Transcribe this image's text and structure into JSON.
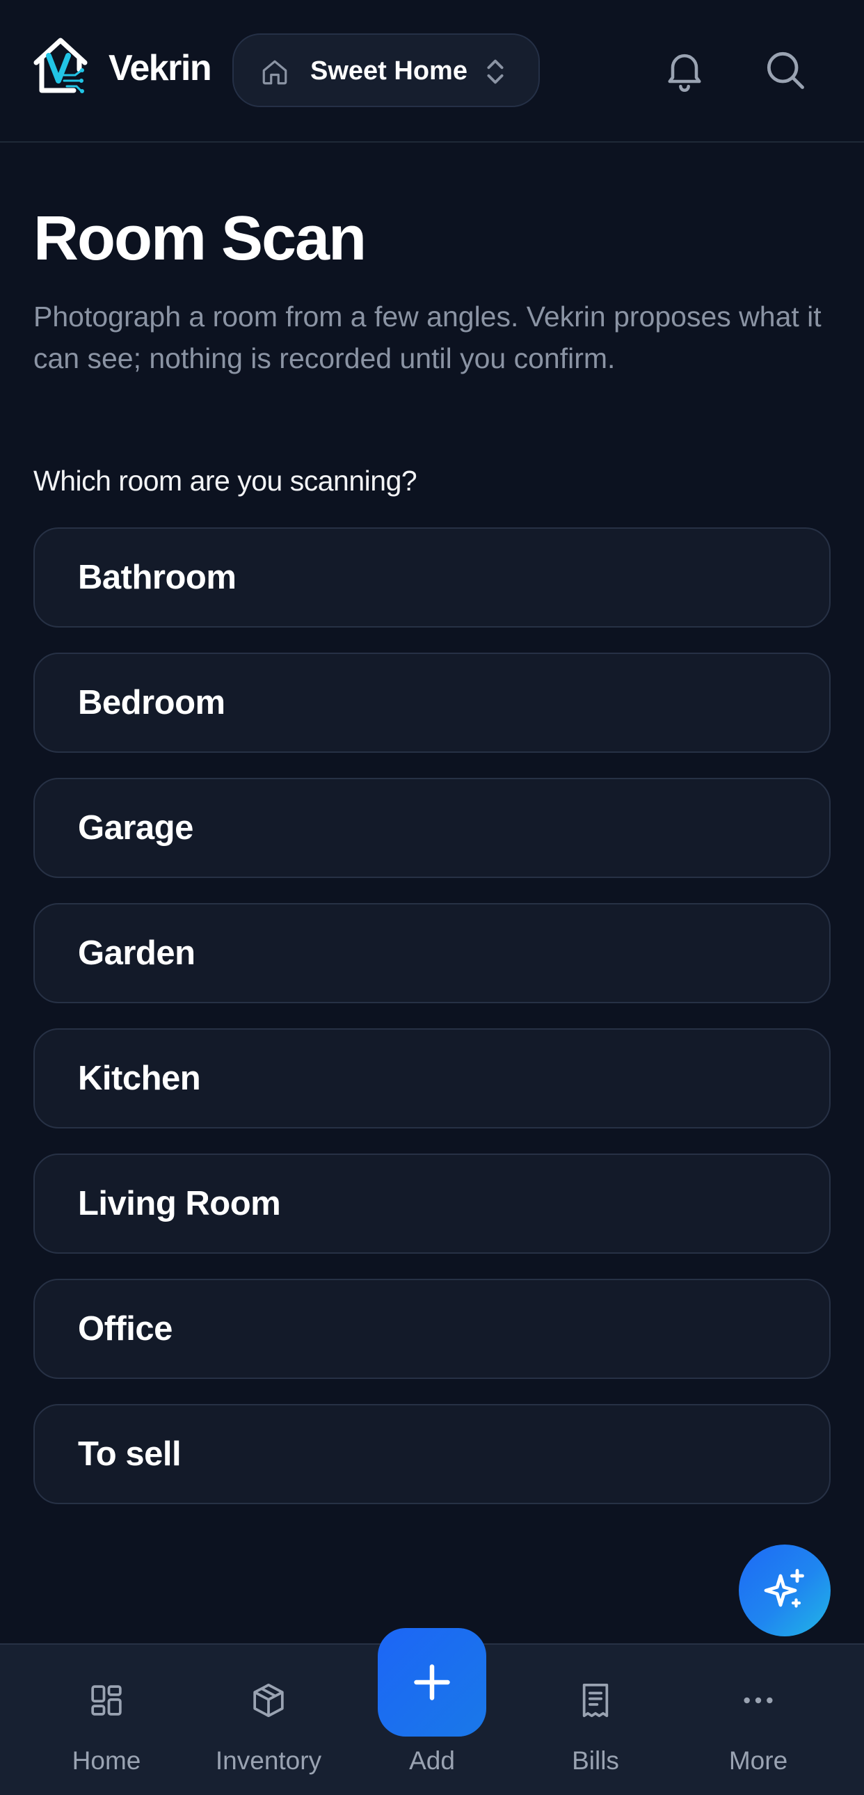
{
  "header": {
    "brand": "Vekrin",
    "home_switcher_label": "Sweet Home",
    "icons": {
      "logo": "vekrin-logo",
      "home": "house-icon",
      "switch": "chevron-updown-icon",
      "bell": "bell-icon",
      "search": "search-icon"
    }
  },
  "main": {
    "title": "Room Scan",
    "subtitle": "Photograph a room from a few angles. Vekrin proposes what it can see; nothing is recorded until you confirm.",
    "question": "Which room are you scanning?",
    "rooms": [
      {
        "label": "Bathroom"
      },
      {
        "label": "Bedroom"
      },
      {
        "label": "Garage"
      },
      {
        "label": "Garden"
      },
      {
        "label": "Kitchen"
      },
      {
        "label": "Living Room"
      },
      {
        "label": "Office"
      },
      {
        "label": "To sell"
      }
    ]
  },
  "ai_fab": {
    "icon": "sparkles-icon"
  },
  "bottom_nav": {
    "items": [
      {
        "label": "Home",
        "icon": "grid-icon"
      },
      {
        "label": "Inventory",
        "icon": "box-icon"
      },
      {
        "label": "Add",
        "icon": "plus-icon"
      },
      {
        "label": "Bills",
        "icon": "receipt-icon"
      },
      {
        "label": "More",
        "icon": "more-dots-icon"
      }
    ]
  },
  "colors": {
    "background": "#0c1220",
    "card": "#131a29",
    "card_border": "#273145",
    "accent": "#1c66f6",
    "logo_accent": "#22c5e6",
    "muted_text": "#8b94a4",
    "nav_text": "#9aa3b2"
  }
}
